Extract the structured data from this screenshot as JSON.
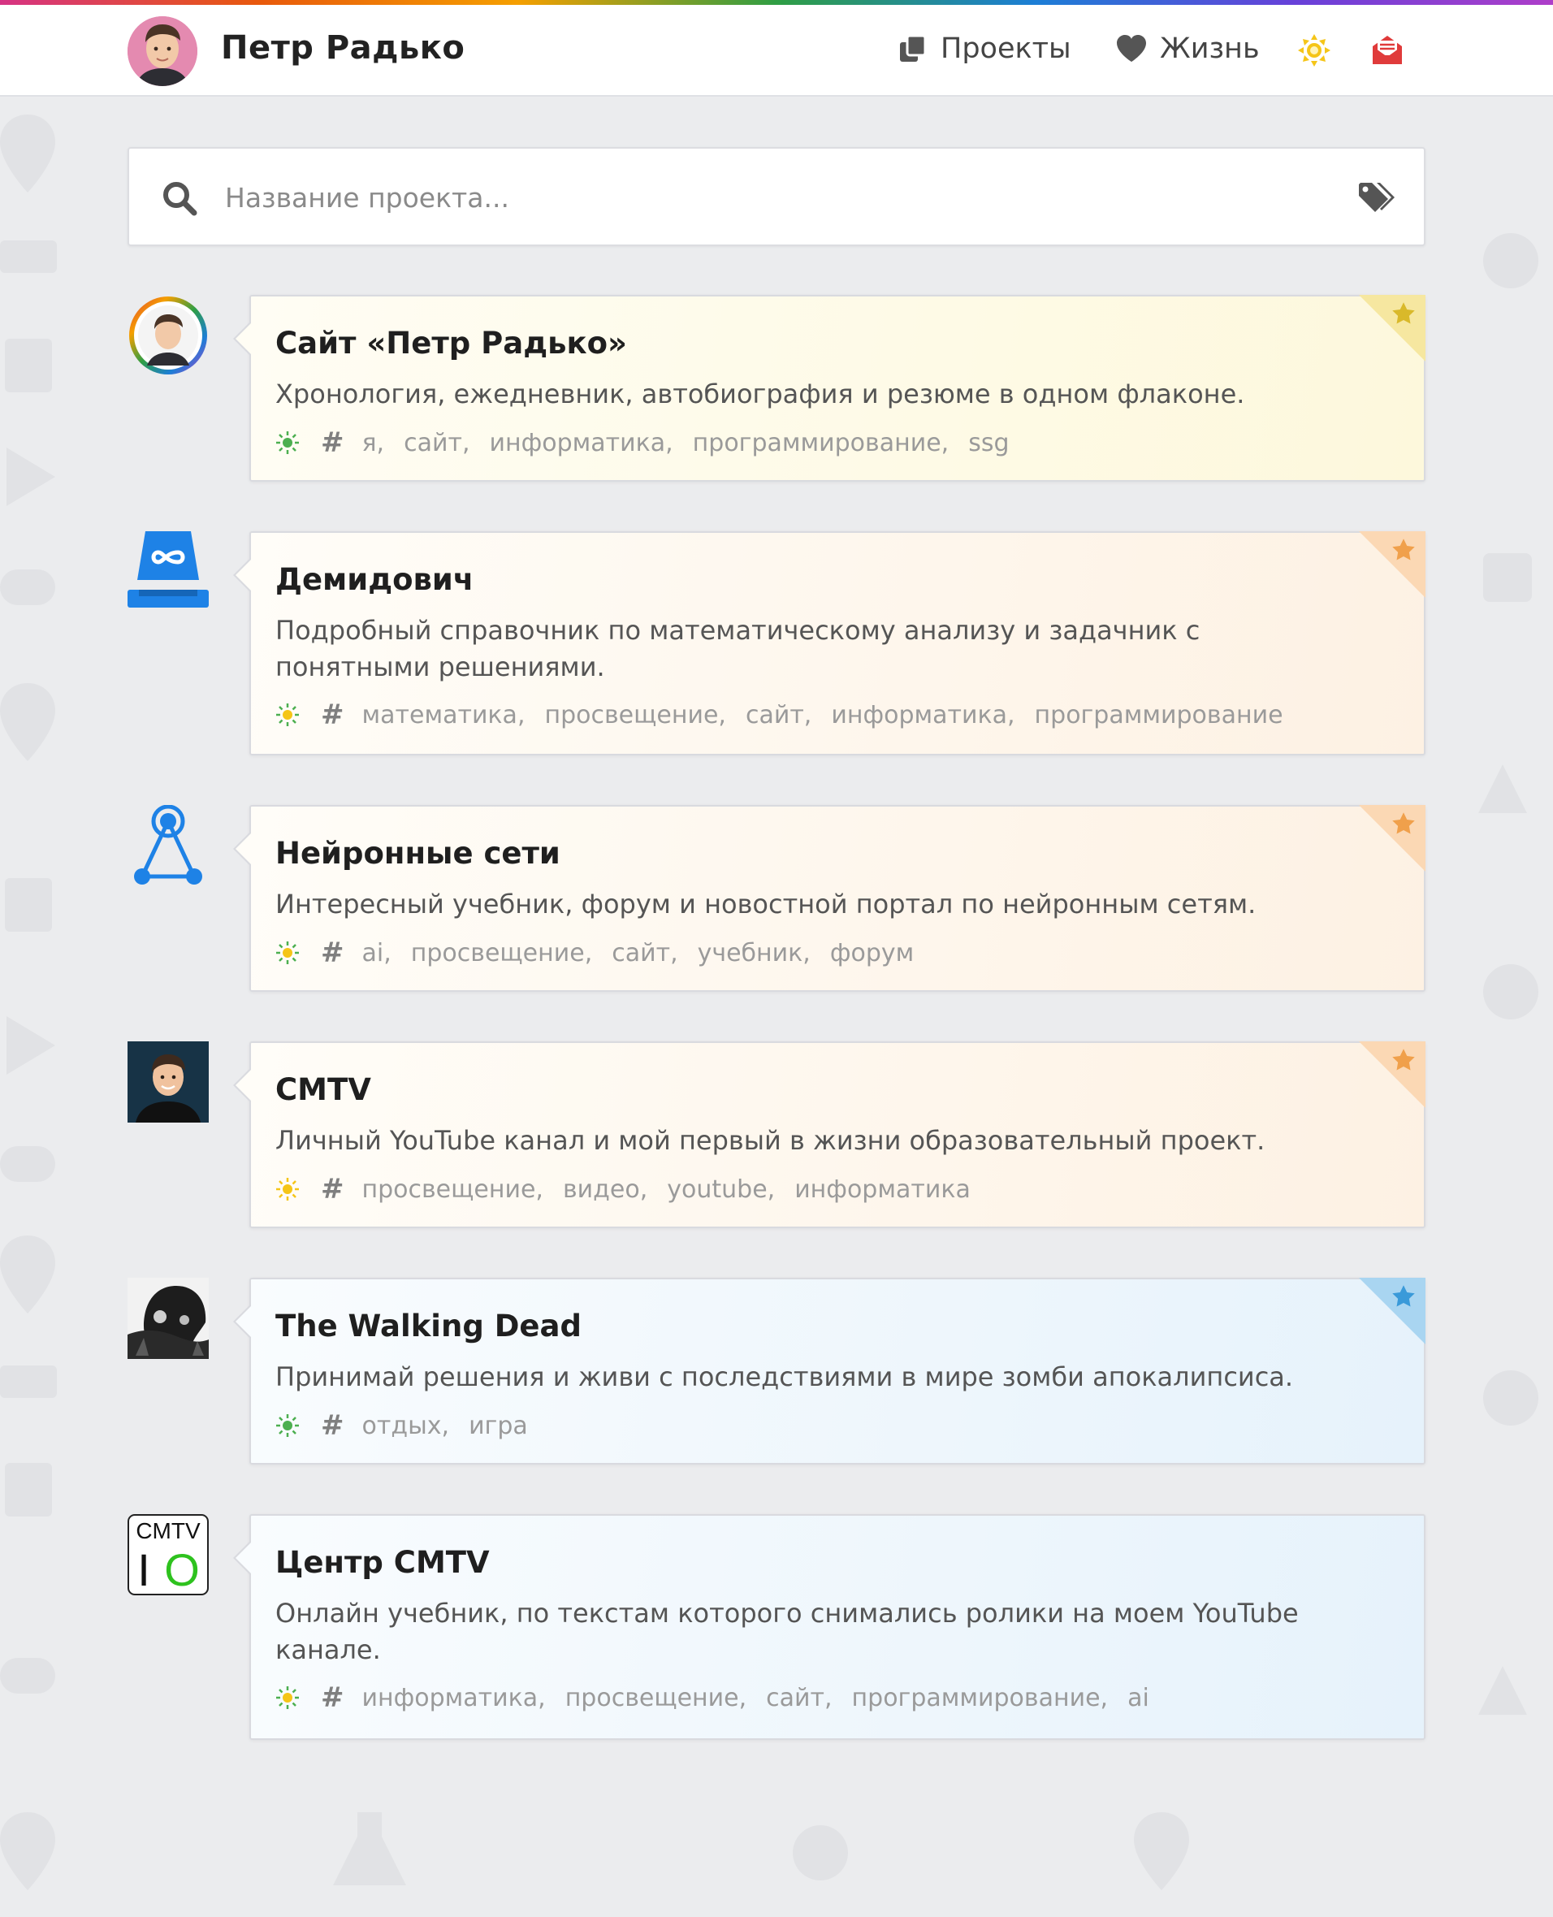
{
  "header": {
    "brand_name": "Петр Радько",
    "nav": [
      {
        "label": "Проекты",
        "icon": "copy-icon"
      },
      {
        "label": "Жизнь",
        "icon": "heart-icon"
      }
    ],
    "theme_icon": "sun-icon",
    "mail_icon": "mail-icon"
  },
  "search": {
    "placeholder": "Название проекта...",
    "value": ""
  },
  "colors": {
    "yellow_star": "#d9b92a",
    "orange_star": "#f0a04b",
    "blue_star": "#3a9ad9",
    "sun_yellow": "#f5c518",
    "mail_red": "#e03b3b"
  },
  "projects": [
    {
      "title": "Сайт «Петр Радько»",
      "description": "Хронология, ежедневник, автобиография и резюме в одном флаконе.",
      "tags": [
        "я,",
        "сайт,",
        "информатика,",
        "программирование,",
        "ssg"
      ],
      "theme": "yellow",
      "logo": "avatar-rainbow-ring"
    },
    {
      "title": "Демидович",
      "description": "Подробный справочник по математическому анализу и задачник с понятными решениями.",
      "tags": [
        "математика,",
        "просвещение,",
        "сайт,",
        "информатика,",
        "программирование"
      ],
      "theme": "orange",
      "logo": "infinity-bucket-logo"
    },
    {
      "title": "Нейронные сети",
      "description": "Интересный учебник, форум и новостной портал по нейронным сетям.",
      "tags": [
        "ai,",
        "просвещение,",
        "сайт,",
        "учебник,",
        "форум"
      ],
      "theme": "orange",
      "logo": "network-triangle-logo"
    },
    {
      "title": "CMTV",
      "description": "Личный YouTube канал и мой первый в жизни образовательный проект.",
      "tags": [
        "просвещение,",
        "видео,",
        "youtube,",
        "информатика"
      ],
      "theme": "orange",
      "logo": "portrait-photo"
    },
    {
      "title": "The Walking Dead",
      "description": "Принимай решения и живи с последствиями в мире зомби апокалипсиса.",
      "tags": [
        "отдых,",
        "игра"
      ],
      "theme": "blue",
      "logo": "walking-dead-logo"
    },
    {
      "title": "Центр CMTV",
      "description": "Онлайн учебник, по текстам которого снимались ролики на моем YouTube канале.",
      "tags": [
        "информатика,",
        "просвещение,",
        "сайт,",
        "программирование,",
        "ai"
      ],
      "theme": "blue",
      "logo": "cmtv-io-logo",
      "logo_text_top": "CMTV",
      "logo_text_bottom_left": "I",
      "logo_text_bottom_right": "O"
    }
  ]
}
